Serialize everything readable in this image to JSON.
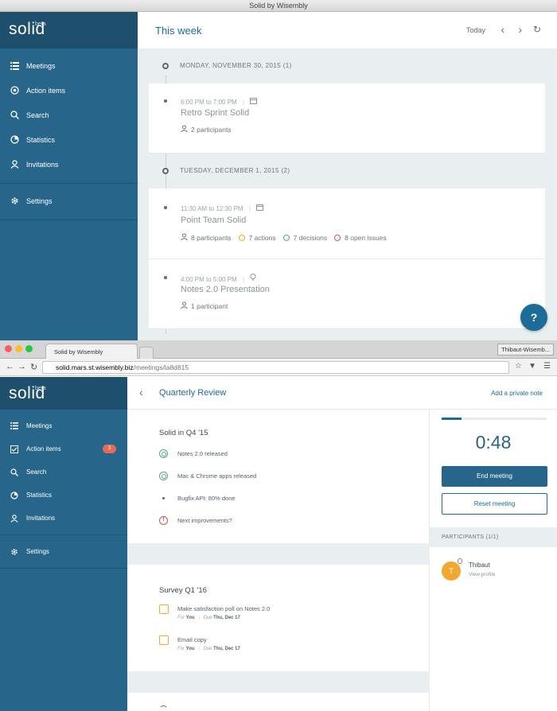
{
  "window1": {
    "title": "Solid by Wisembly",
    "logo": "solid",
    "logo_badge": "beta",
    "nav": [
      {
        "label": "Meetings"
      },
      {
        "label": "Action items"
      },
      {
        "label": "Search"
      },
      {
        "label": "Statistics"
      },
      {
        "label": "Invitations"
      },
      {
        "label": "Settings"
      }
    ],
    "header": {
      "title": "This week",
      "today": "Today"
    },
    "days": [
      {
        "label": "MONDAY, NOVEMBER 30, 2015",
        "count": "(1)"
      },
      {
        "label": "TUESDAY, DECEMBER 1, 2015",
        "count": "(2)"
      }
    ],
    "meetings": [
      {
        "time": "6:00 PM to 7:00 PM",
        "title": "Retro Sprint Solid",
        "participants": "2 participants"
      },
      {
        "time": "11:30 AM to 12:30 PM",
        "title": "Point Team Solid",
        "participants": "8 participants",
        "actions": "7 actions",
        "decisions": "7 decisions",
        "issues": "8 open issues"
      },
      {
        "time": "4:00 PM to 5:00 PM",
        "title": "Notes 2.0 Presentation",
        "participants": "1 participant"
      }
    ],
    "help": "?"
  },
  "window2": {
    "tab_title": "Solid by Wisembly",
    "profile": "Thibaut-Wisemb...",
    "url_domain": "solid.mars.st.wisembly.biz",
    "url_path": "/meetings/la8d815",
    "logo": "solid",
    "logo_badge": "beta",
    "nav": [
      {
        "label": "Meetings"
      },
      {
        "label": "Action items",
        "badge": "3"
      },
      {
        "label": "Search"
      },
      {
        "label": "Statistics"
      },
      {
        "label": "Invitations"
      },
      {
        "label": "Settings"
      }
    ],
    "header": {
      "title": "Quarterly Review",
      "note": "Add a private note"
    },
    "section1": {
      "title": "Solid in Q4 '15",
      "items": [
        "Notes 2.0 released",
        "Mac & Chrome apps released",
        "Bugfix API: 80% done",
        "Next improvements?"
      ]
    },
    "section2": {
      "title": "Survey Q1 '16",
      "todos": [
        {
          "label": "Make satisfaction poll on Notes 2.0",
          "for": "For",
          "who": "You",
          "sep": "|",
          "due": "Due",
          "date": "Thu, Dec 17"
        },
        {
          "label": "Email copy",
          "for": "For",
          "who": "You",
          "sep": "|",
          "due": "Due",
          "date": "Thu, Dec 17"
        }
      ]
    },
    "panel": {
      "progress": 0.19,
      "timer": "0:48",
      "end": "End meeting",
      "reset": "Reset meeting",
      "participants_head": "PARTICIPANTS (1/1)",
      "participant_name": "Thibaut",
      "participant_initial": "T",
      "participant_link": "View profile"
    }
  },
  "colors": {
    "sidebar": "#27668a",
    "sidebar_dark": "#1e4f6c",
    "accent": "#1d6b98",
    "badge": "#e46c55",
    "check": "#f0a830"
  }
}
